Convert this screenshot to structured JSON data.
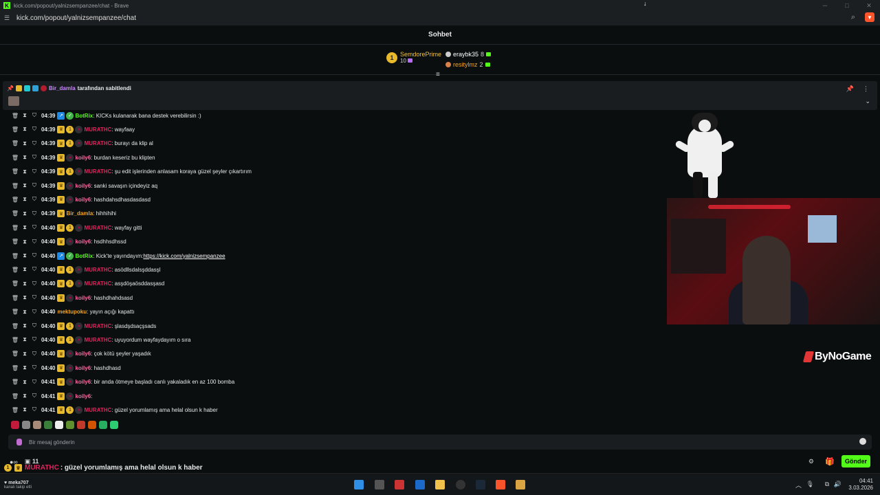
{
  "browser": {
    "title": "kick.com/popout/yalnizsempanzee/chat - Brave",
    "url": "kick.com/popout/yalnizsempanzee/chat"
  },
  "chat_header": {
    "title": "Sohbet"
  },
  "leaderboard": {
    "first": {
      "rank": "1",
      "name": "SemdorePrime",
      "count": "10"
    },
    "second": {
      "name": "eraybk35",
      "count": "8"
    },
    "third": {
      "name": "resitylmz",
      "count": "2"
    }
  },
  "pinned": {
    "user": "Bir_damla",
    "text": "tarafından sabitlendi"
  },
  "messages": [
    {
      "time": "04:39",
      "user": "BotRix",
      "text": ": KICKs kulanarak bana destek verebilirsin :)",
      "color": "#53fc18"
    },
    {
      "time": "04:39",
      "user": "MURATHC",
      "text": ": wayfaay",
      "color": "#e0245e"
    },
    {
      "time": "04:39",
      "user": "MURATHC",
      "text": ": burayı da klip al",
      "color": "#e0245e"
    },
    {
      "time": "04:39",
      "user": "koily6",
      "text": ": burdan keseriz bu klipten",
      "color": "#f76ca3"
    },
    {
      "time": "04:39",
      "user": "MURATHC",
      "text": ": şu edit işlerinden anlasam koraya güzel şeyler çıkartırım",
      "color": "#e0245e"
    },
    {
      "time": "04:39",
      "user": "koily6",
      "text": ": sanki savaşın içindeyiz aq",
      "color": "#f76ca3"
    },
    {
      "time": "04:39",
      "user": "koily6",
      "text": ": hashdahsdhasdasdasd",
      "color": "#f76ca3"
    },
    {
      "time": "04:39",
      "user": "Bir_damla",
      "text": ": hihhihihi",
      "color": "#f5a623"
    },
    {
      "time": "04:40",
      "user": "MURATHC",
      "text": ": wayfay gitti",
      "color": "#e0245e"
    },
    {
      "time": "04:40",
      "user": "koily6",
      "text": ": hsdhhsdhssd",
      "color": "#f76ca3"
    },
    {
      "time": "04:40",
      "user": "BotRix",
      "text": ": Kick'te yayındayım: ",
      "link": "https://kick.com/yalnizsempanzee",
      "color": "#53fc18"
    },
    {
      "time": "04:40",
      "user": "MURATHC",
      "text": ": asödllsdalsşddasşl",
      "color": "#e0245e"
    },
    {
      "time": "04:40",
      "user": "MURATHC",
      "text": ": asşdöşaösddasşasd",
      "color": "#e0245e"
    },
    {
      "time": "04:40",
      "user": "koily6",
      "text": ": hashdhahdsasd",
      "color": "#f76ca3"
    },
    {
      "time": "04:40",
      "user": "mektupoku",
      "text": ": yayın açığı kapattı",
      "color": "#f5a623"
    },
    {
      "time": "04:40",
      "user": "MURATHC",
      "text": ": şlasdşdsaçşsads",
      "color": "#e0245e"
    },
    {
      "time": "04:40",
      "user": "MURATHC",
      "text": ": uyuyordum wayfaydayım o sıra",
      "color": "#e0245e"
    },
    {
      "time": "04:40",
      "user": "koily6",
      "text": ": çok kötü şeyler yaşadık",
      "color": "#f76ca3"
    },
    {
      "time": "04:40",
      "user": "koily6",
      "text": ": hashdhasd",
      "color": "#f76ca3"
    },
    {
      "time": "04:41",
      "user": "koily6",
      "text": ": bir anda ötmeye başladı canlı yakaladık en az 100 bomba",
      "color": "#f76ca3"
    },
    {
      "time": "04:41",
      "user": "koily6",
      "text": ":",
      "color": "#f76ca3"
    },
    {
      "time": "04:41",
      "user": "MURATHC",
      "text": ": güzel yorumlamış ama helal olsun k haber",
      "color": "#e0245e"
    }
  ],
  "input": {
    "placeholder": "Bir mesaj gönderin",
    "send": "Gönder"
  },
  "viewer_count": "11",
  "overlay": {
    "user": "MURATHC",
    "text": ": güzel yorumlamış ama helal olsun k haber"
  },
  "follow_alert": {
    "user": "meka707",
    "text": "kanalı takip etti"
  },
  "brand": "ByNoGame",
  "clock": {
    "time": "04:41",
    "date": "3.03.2026"
  }
}
